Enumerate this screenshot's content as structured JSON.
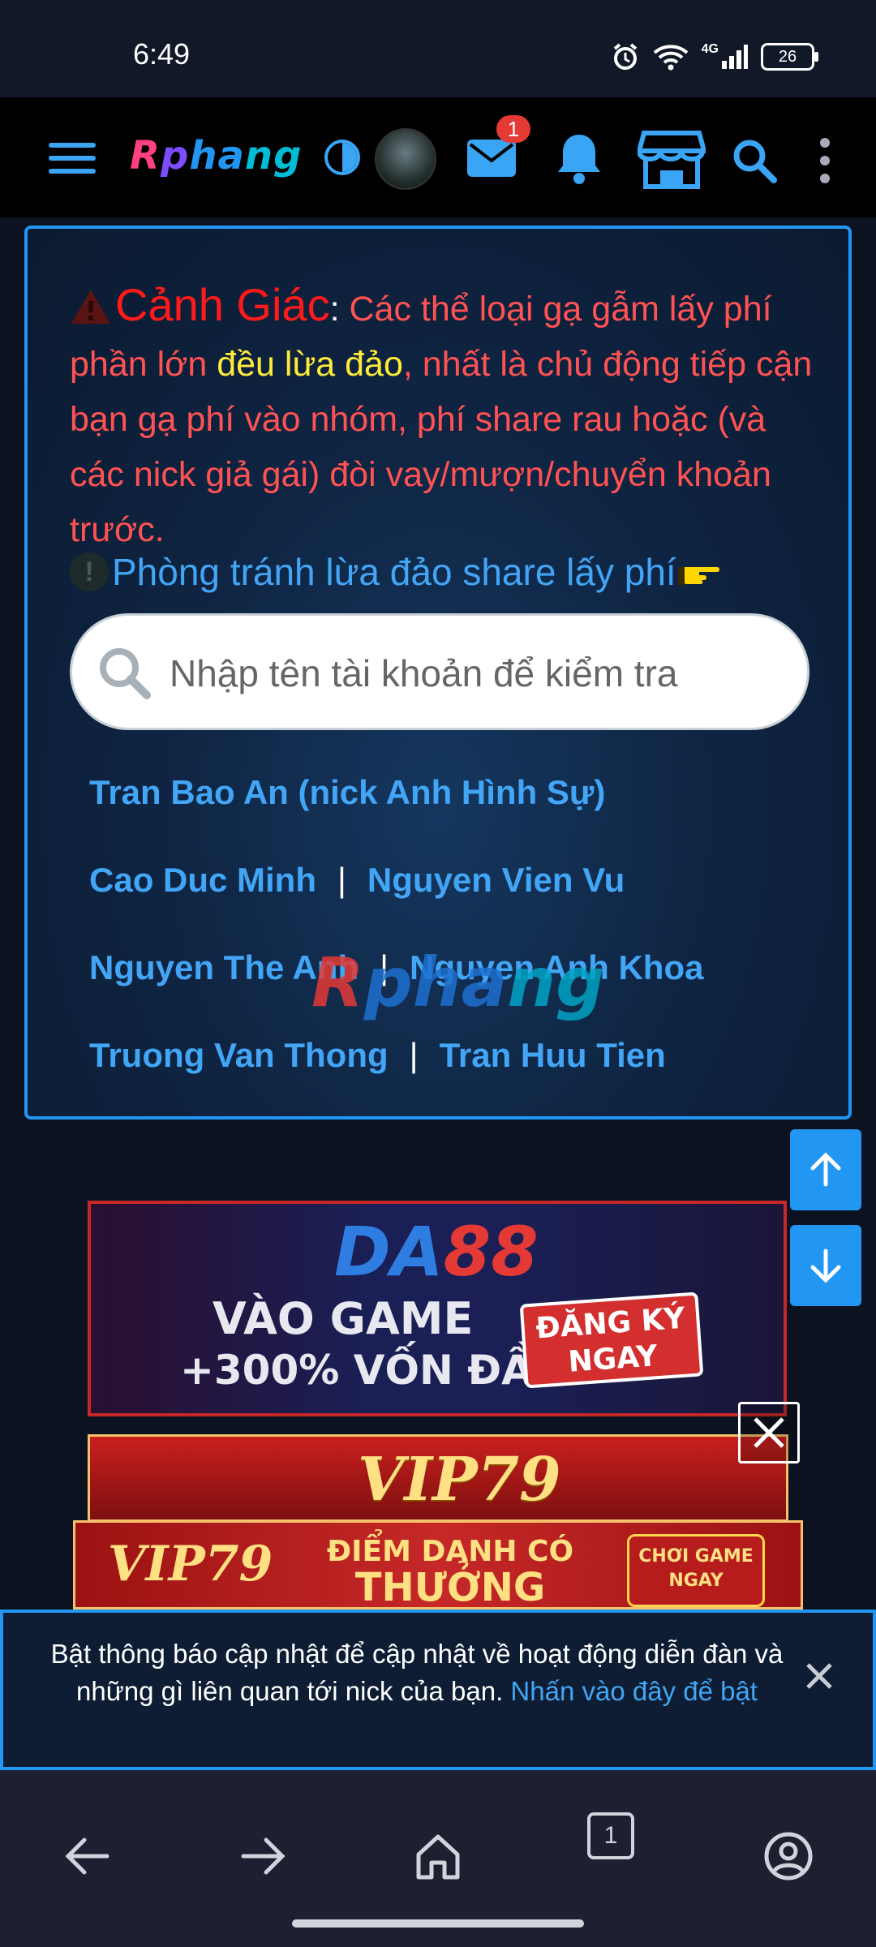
{
  "status_bar": {
    "time": "6:49",
    "network": "4G",
    "battery": "26"
  },
  "top_nav": {
    "logo": [
      "R",
      "p",
      "ha",
      "ng"
    ],
    "mail_badge": "1"
  },
  "warning": {
    "title": "Cảnh Giác",
    "colon": ":",
    "text_1": " Các thể loại gạ gẫm lấy phí phần lớn ",
    "highlight": "đều lừa đảo",
    "text_2": ", nhất là chủ động tiếp cận bạn gạ phí vào nhóm, phí share rau hoặc (và các nick giả gái) đòi vay/mượn/chuyển khoản trước.",
    "tip_icon": "!",
    "tip_link": "Phòng tránh lừa đảo share lấy phí"
  },
  "search": {
    "placeholder": "Nhập tên tài khoản để kiểm tra"
  },
  "scam_names": {
    "row1": {
      "a": "Tran Bao An (nick Anh Hình Sự)"
    },
    "row2": {
      "a": "Cao Duc Minh",
      "b": "Nguyen Vien Vu"
    },
    "row3": {
      "a": "Nguyen The Anh",
      "b": "Nguyen Anh Khoa"
    },
    "row4": {
      "a": "Truong Van Thong",
      "b": "Tran Huu Tien"
    },
    "separator": "|"
  },
  "watermark": [
    "R",
    "pha",
    "ng"
  ],
  "ads": {
    "da88": {
      "brand_1": "DA",
      "brand_2": "88",
      "line1": "VÀO GAME",
      "line2": "+300% VỐN ĐẦU",
      "cta_1": "ĐĂNG KÝ",
      "cta_2": "NGAY"
    },
    "vip79_top": {
      "brand": "VIP79"
    },
    "vip79_bottom": {
      "brand": "VIP79",
      "line1": "ĐIỂM DANH CÓ",
      "line2": "THƯỞNG",
      "cta_1": "CHƠI GAME",
      "cta_2": "NGAY"
    }
  },
  "notification": {
    "text": "Bật thông báo cập nhật để cập nhật về hoạt động diễn đàn và những gì liên quan tới nick của bạn. ",
    "link": "Nhấn vào đây để bật"
  },
  "browser_bar": {
    "tab_count": "1"
  },
  "colors": {
    "accent": "#2196f3",
    "warning": "#ff5252",
    "highlight": "#ffeb3b",
    "link": "#42a5f5"
  }
}
